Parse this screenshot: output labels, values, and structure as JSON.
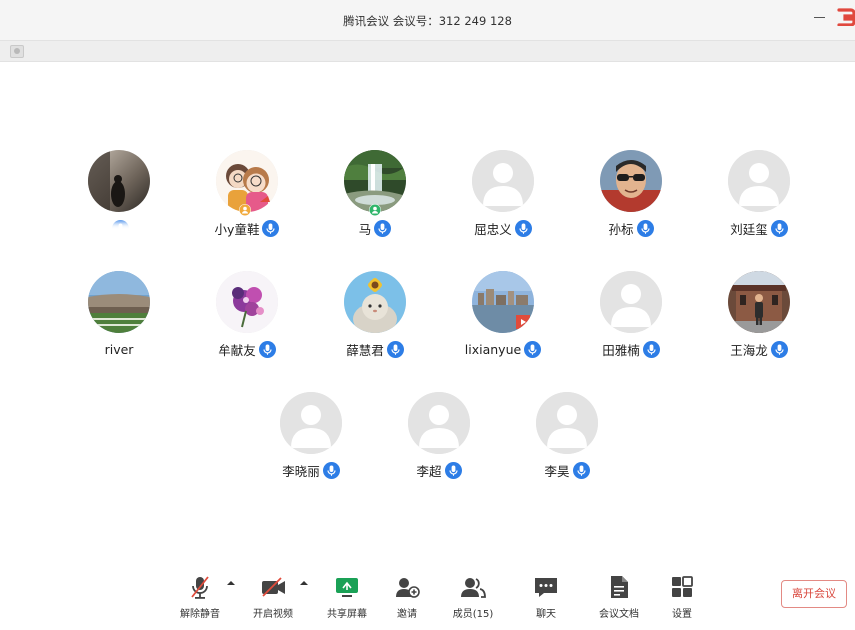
{
  "window": {
    "title": "腾讯会议 会议号：312 249 128",
    "minimize_label": "—"
  },
  "colors": {
    "mic_blue": "#2d7de6",
    "leave_red": "#d9473d",
    "share_green": "#1aa156",
    "host_green": "#2fb56a"
  },
  "participants": [
    {
      "name": "",
      "avatar": "photo-dark-room"
    },
    {
      "name": "小y童鞋",
      "avatar": "cartoon-couple"
    },
    {
      "name": "马",
      "avatar": "photo-waterfall",
      "host": true
    },
    {
      "name": "屈忠义",
      "avatar": "default-person-icon"
    },
    {
      "name": "孙标",
      "avatar": "photo-man-glasses"
    },
    {
      "name": "刘廷玺",
      "avatar": "default-person-icon"
    },
    {
      "name": "river",
      "avatar": "photo-stadium"
    },
    {
      "name": "牟献友",
      "avatar": "photo-purple-flower"
    },
    {
      "name": "薛慧君",
      "avatar": "photo-cat-sunflower"
    },
    {
      "name": "lixianyue",
      "avatar": "photo-city-river"
    },
    {
      "name": "田雅楠",
      "avatar": "default-person-icon"
    },
    {
      "name": "王海龙",
      "avatar": "photo-man-building"
    },
    {
      "name": "李晓丽",
      "avatar": "default-person-icon"
    },
    {
      "name": "李超",
      "avatar": "default-person-icon"
    },
    {
      "name": "李昊",
      "avatar": "default-person-icon"
    }
  ],
  "toolbar": {
    "unmute": "解除静音",
    "start_video": "开启视频",
    "share_screen": "共享屏幕",
    "invite": "邀请",
    "members": "成员(15)",
    "chat": "聊天",
    "docs": "会议文档",
    "settings": "设置",
    "leave": "离开会议"
  }
}
